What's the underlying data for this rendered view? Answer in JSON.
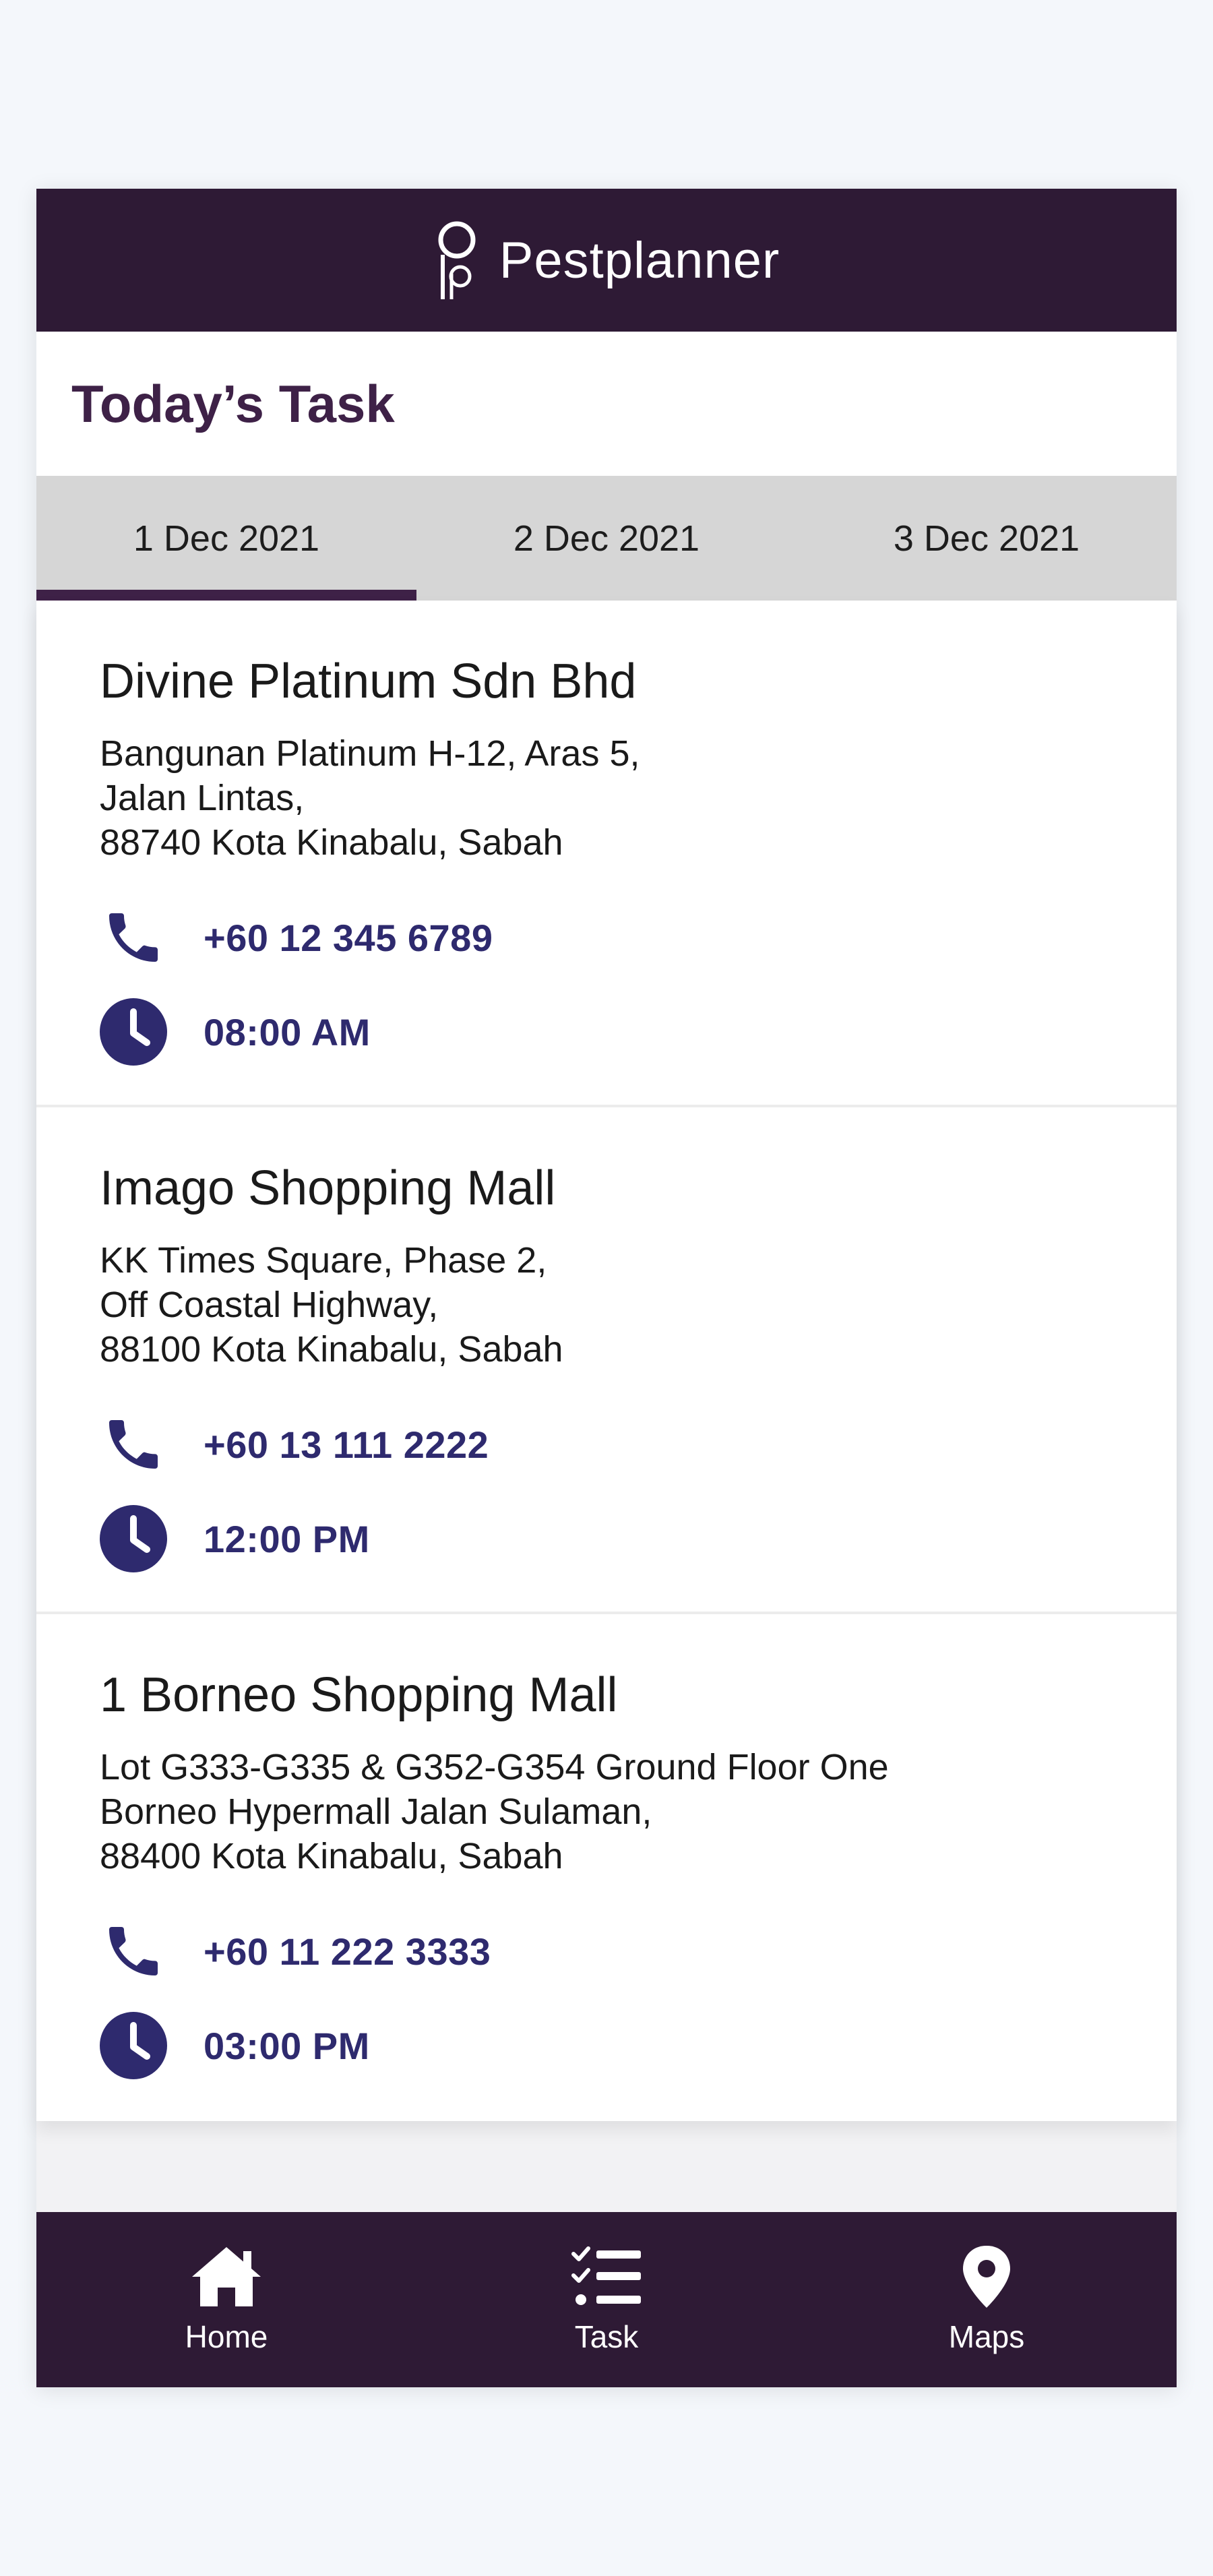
{
  "header": {
    "app_name": "Pestplanner",
    "logo_icon": "pestplanner-logo"
  },
  "page": {
    "title": "Today’s Task"
  },
  "tabs": [
    {
      "label": "1 Dec 2021",
      "active": true
    },
    {
      "label": "2 Dec 2021",
      "active": false
    },
    {
      "label": "3 Dec 2021",
      "active": false
    }
  ],
  "tasks": [
    {
      "name": "Divine Platinum Sdn Bhd",
      "address": [
        "Bangunan Platinum H-12, Aras 5,",
        "Jalan Lintas,",
        "88740 Kota Kinabalu, Sabah"
      ],
      "phone": "+60 12 345 6789",
      "time": "08:00 AM"
    },
    {
      "name": "Imago Shopping Mall",
      "address": [
        "KK Times Square, Phase 2,",
        "Off Coastal Highway,",
        "88100 Kota Kinabalu, Sabah"
      ],
      "phone": "+60 13 111 2222",
      "time": "12:00 PM"
    },
    {
      "name": "1 Borneo Shopping Mall",
      "address": [
        "Lot G333-G335 & G352-G354 Ground Floor One",
        "Borneo Hypermall Jalan Sulaman,",
        "88400 Kota Kinabalu, Sabah"
      ],
      "phone": "+60 11 222 3333",
      "time": "03:00 PM"
    }
  ],
  "nav": [
    {
      "label": "Home",
      "icon": "home-icon"
    },
    {
      "label": "Task",
      "icon": "task-list-icon"
    },
    {
      "label": "Maps",
      "icon": "map-pin-icon"
    }
  ],
  "colors": {
    "header_bg": "#2e1a35",
    "accent": "#3e2147",
    "info_text": "#2e2a6e",
    "tab_bg": "#d6d6d6"
  }
}
